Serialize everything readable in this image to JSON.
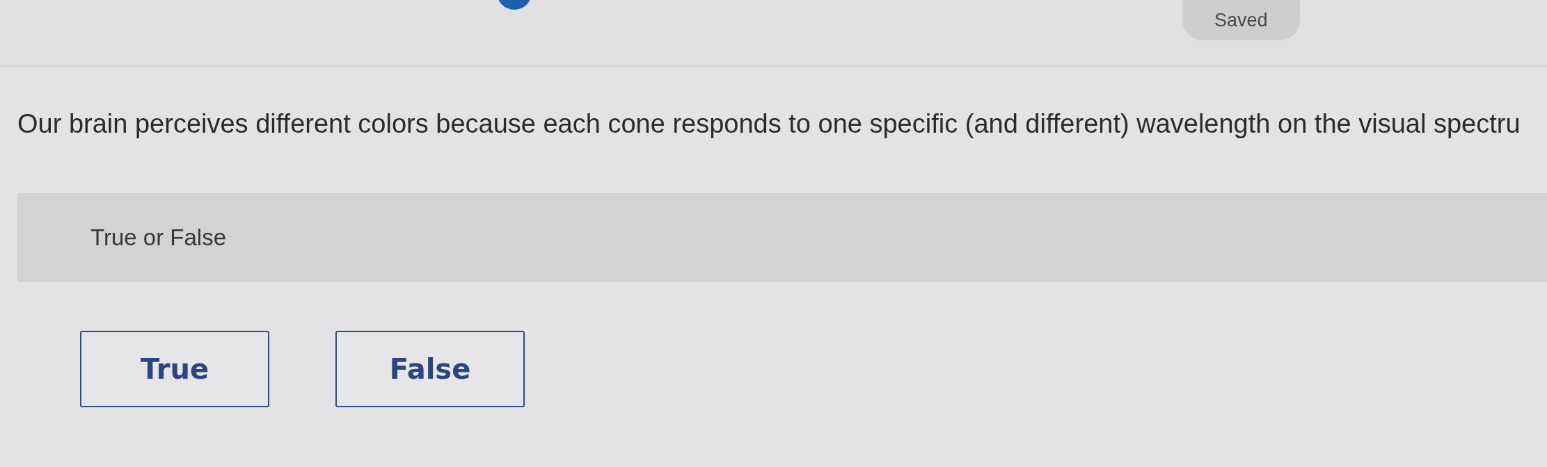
{
  "status": {
    "label": "Saved"
  },
  "question": {
    "prompt": "Our brain perceives different colors because each cone responds to one specific (and different) wavelength on the visual spectru",
    "type_label": "True or False"
  },
  "answers": [
    {
      "label": "True",
      "selected": false
    },
    {
      "label": "False",
      "selected": false
    }
  ]
}
